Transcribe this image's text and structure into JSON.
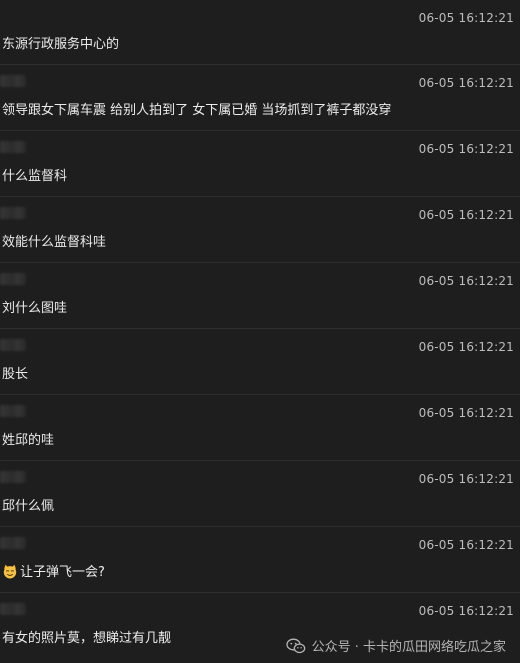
{
  "messages": [
    {
      "time": "06-05 16:12:21",
      "text": "东源行政服务中心的"
    },
    {
      "time": "06-05 16:12:21",
      "text": "领导跟女下属车震 给别人拍到了 女下属已婚 当场抓到了裤子都没穿"
    },
    {
      "time": "06-05 16:12:21",
      "text": "什么监督科"
    },
    {
      "time": "06-05 16:12:21",
      "text": "效能什么监督科哇"
    },
    {
      "time": "06-05 16:12:21",
      "text": "刘什么图哇"
    },
    {
      "time": "06-05 16:12:21",
      "text": "股长"
    },
    {
      "time": "06-05 16:12:21",
      "text": "姓邱的哇"
    },
    {
      "time": "06-05 16:12:21",
      "text": "邱什么佩"
    },
    {
      "time": "06-05 16:12:21",
      "text": "让子弹飞一会?",
      "icon": "smirk-emoji-icon"
    },
    {
      "time": "06-05 16:12:21",
      "text": "有女的照片莫，想睇过有几靓"
    }
  ],
  "watermark": {
    "text": "公众号 · 卡卡的瓜田网络吃瓜之家",
    "icon": "wechat-icon"
  }
}
